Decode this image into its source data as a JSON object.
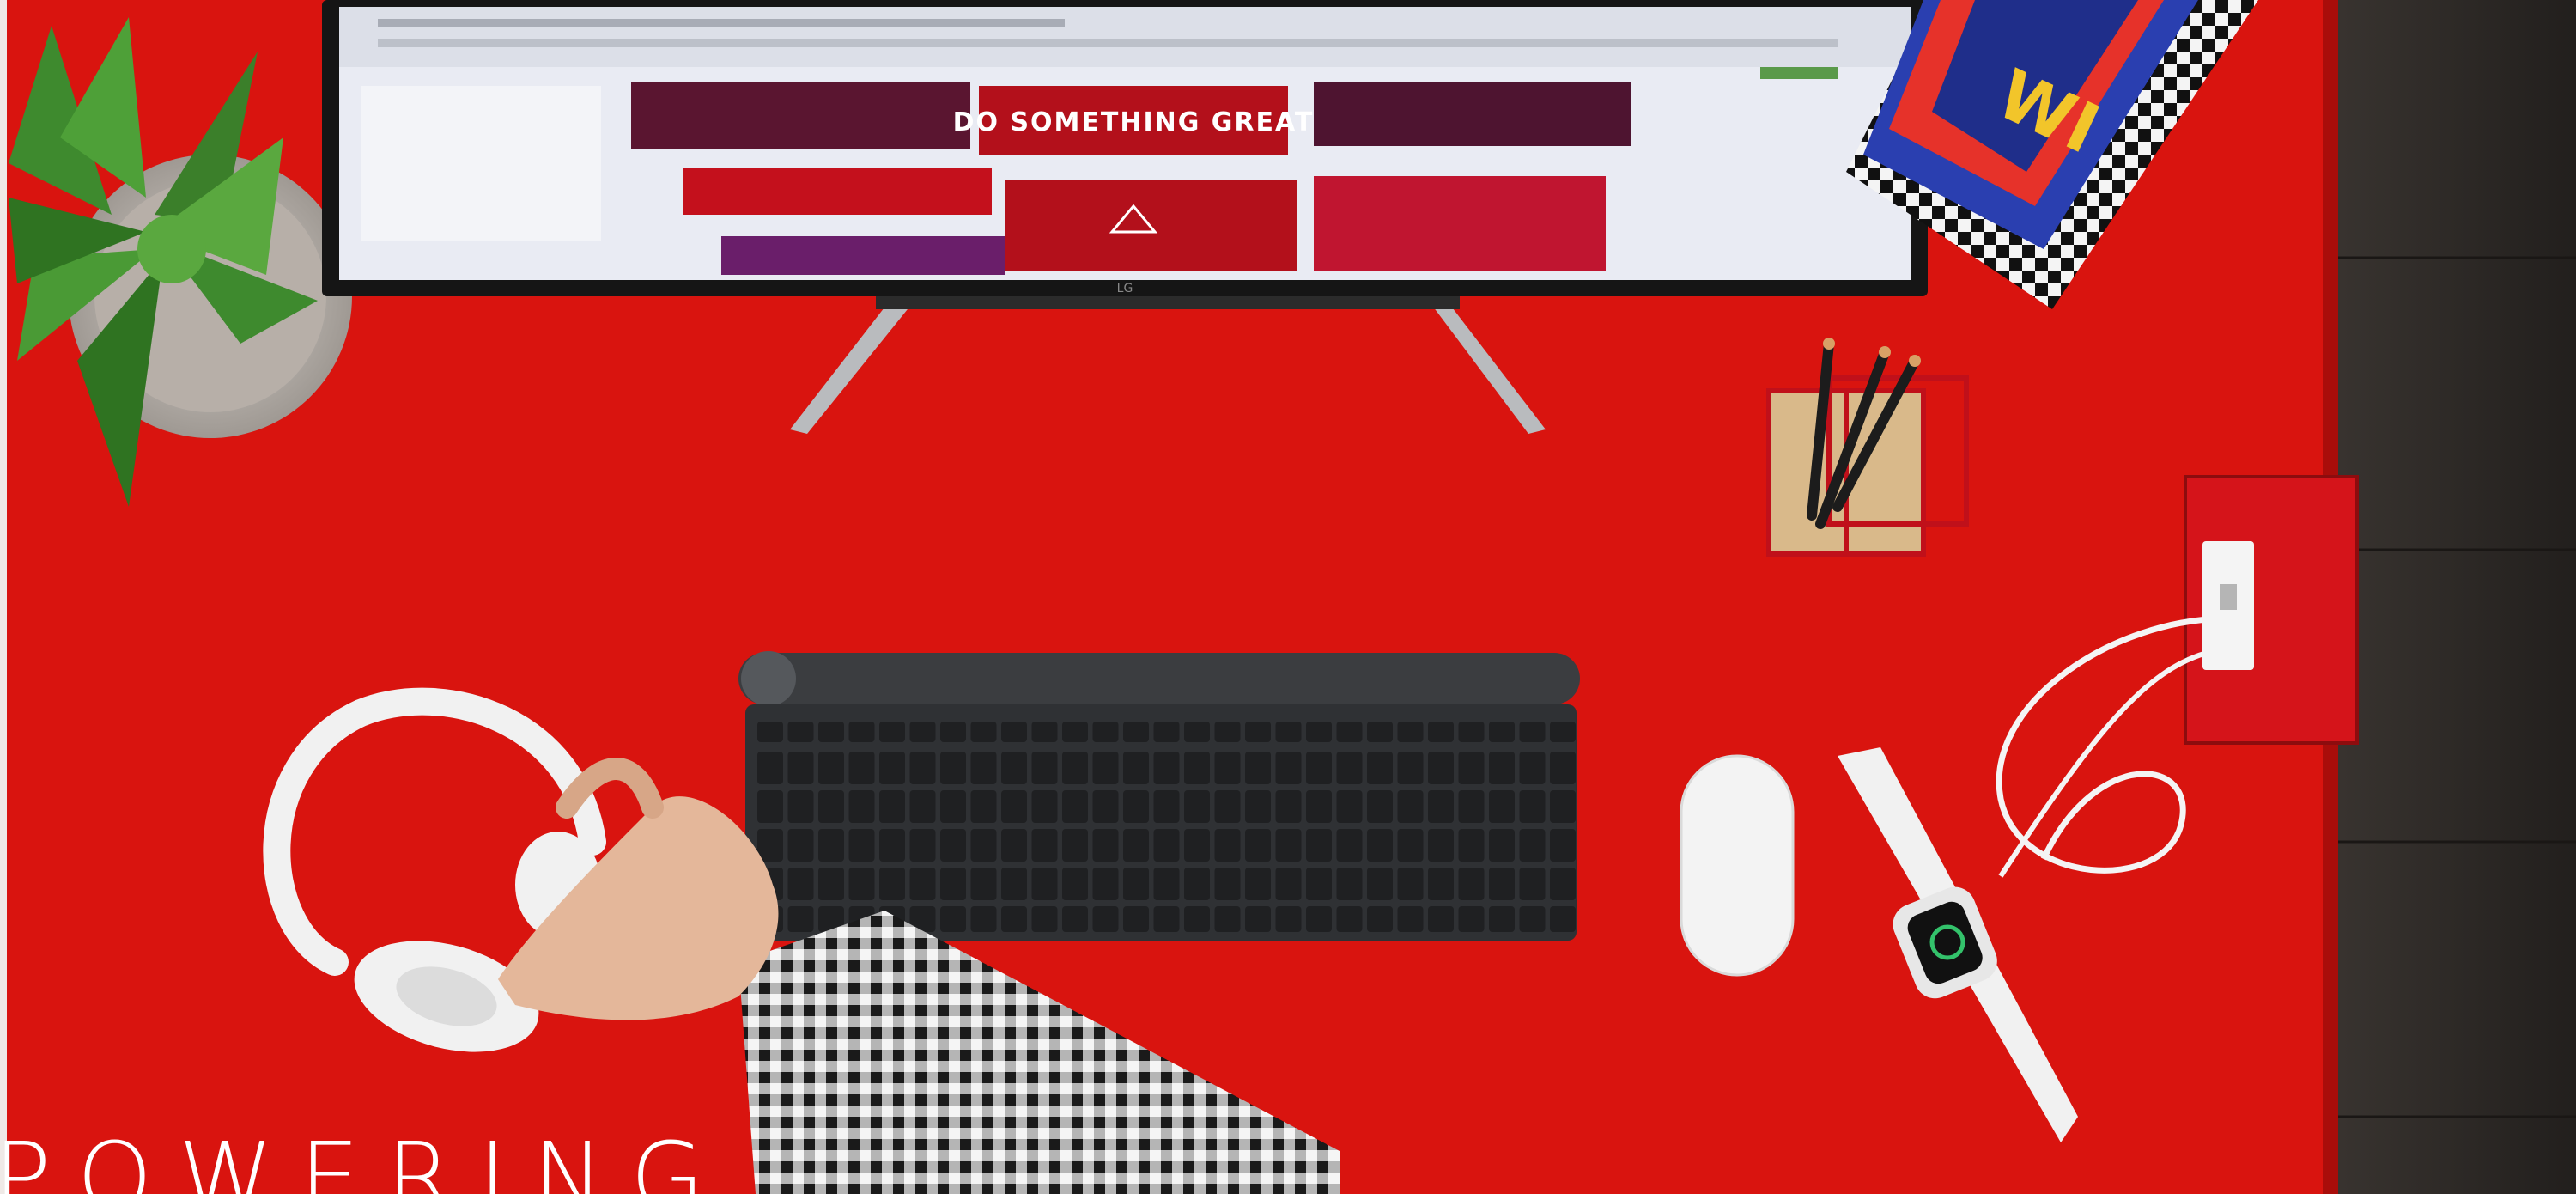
{
  "scene": {
    "headline": "POWERING",
    "monitor_banner": "DO SOMETHING GREAT",
    "monitor_brand": "LG",
    "colors": {
      "desk": "#d9140f",
      "desk_shadow": "#a90d0a",
      "floor": "#2b2724",
      "keyboard": "#3b3d40",
      "white_gear": "#f1f1f1",
      "screen_bg": "#e9ebf3",
      "tile_red": "#c4101c",
      "tile_neon": "#5a1530"
    },
    "objects": [
      {
        "name": "plant",
        "icon": "plant-pot"
      },
      {
        "name": "monitor",
        "icon": "monitor"
      },
      {
        "name": "magazines",
        "icon": "magazine-stack"
      },
      {
        "name": "pencil-holder",
        "icon": "pencil-cup"
      },
      {
        "name": "power-outlet",
        "icon": "outlet-box"
      },
      {
        "name": "keyboard",
        "icon": "keyboard"
      },
      {
        "name": "headphones",
        "icon": "headphones"
      },
      {
        "name": "mouse",
        "icon": "mouse"
      },
      {
        "name": "smartwatch",
        "icon": "watch"
      },
      {
        "name": "hand-arm",
        "icon": "hand"
      }
    ]
  }
}
